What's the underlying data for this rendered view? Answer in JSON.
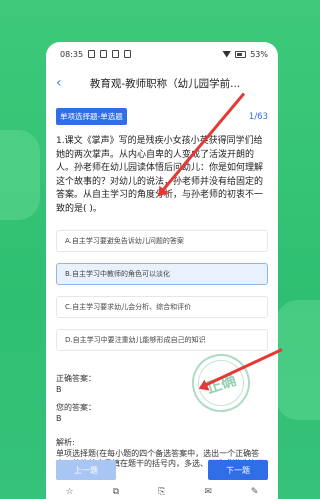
{
  "status_bar": {
    "time": "08:35",
    "battery": "53%"
  },
  "header": {
    "title": "教育观-教师职称（幼儿园学前..."
  },
  "question_meta": {
    "type_tag": "单项选择题-单选题",
    "progress": "1/63"
  },
  "question": {
    "text": "1.课文《掌声》写的是残疾小女孩小英获得同学们给她的两次掌声。从内心自卑的人变成了活泼开朗的人。孙老师在幼儿园读体悟后问幼儿：你是如何理解这个故事的？对幼儿的说法，孙老师并没有给固定的答案。从自主学习的角度分析，与孙老师的初衷不一致的是(  )。"
  },
  "options": [
    {
      "label": "A.自主学习要避免告诉幼儿问题的答案",
      "selected": false
    },
    {
      "label": "B.自主学习中教师的角色可以淡化",
      "selected": true
    },
    {
      "label": "C.自主学习要求幼儿会分析、综合和评价",
      "selected": false
    },
    {
      "label": "D.自主学习中要注重幼儿能够形成自己的知识",
      "selected": false
    }
  ],
  "answers": {
    "correct_label": "正确答案：",
    "correct_value": "B",
    "yours_label": "您的答案：",
    "yours_value": "B"
  },
  "analysis": {
    "label": "解析:",
    "text": "单项选择题(在每小题的四个备选答案中，选出一个正确答案，并将其序号填在题干的括号内，多选、不选或错选均不得分)"
  },
  "stamp": {
    "text": "正确"
  },
  "buttons": {
    "prev": "上一题",
    "next": "下一题"
  },
  "bottom_bar": {
    "icons": [
      "star-icon",
      "copy-icon",
      "clip-icon",
      "message-icon",
      "edit-icon"
    ]
  },
  "colors": {
    "accent": "#2f6ee6",
    "background": "#36c279",
    "arrow": "#e53935"
  }
}
